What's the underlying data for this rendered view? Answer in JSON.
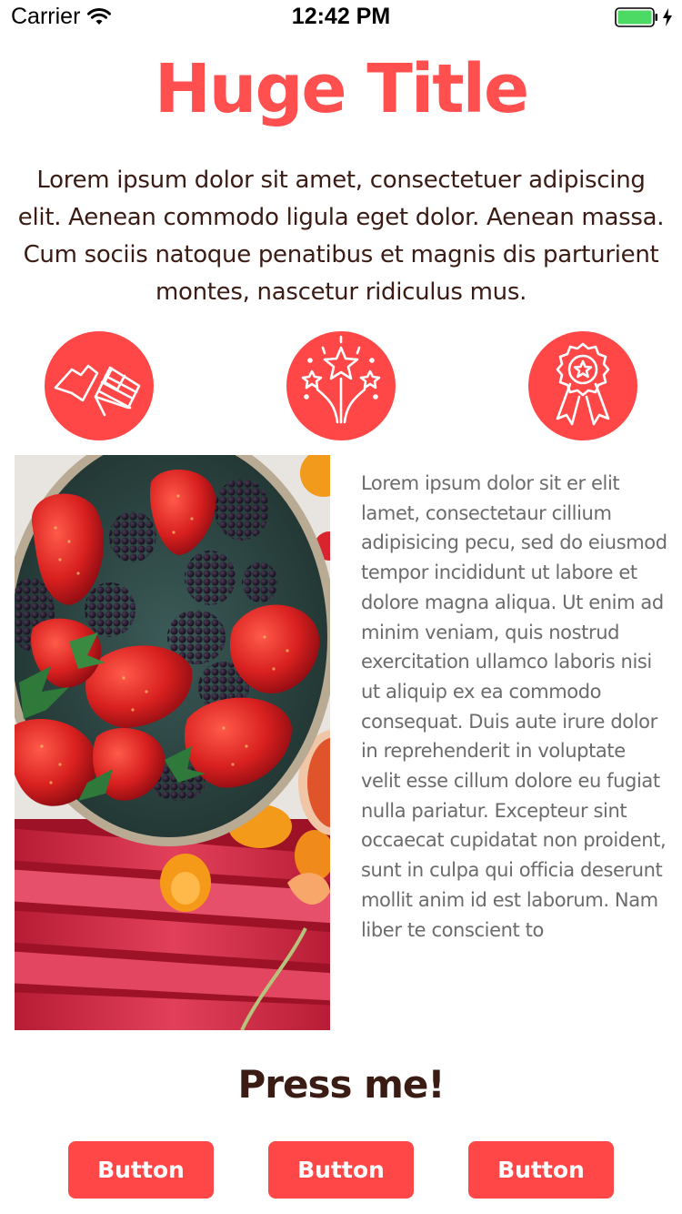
{
  "status_bar": {
    "carrier": "Carrier",
    "time": "12:42 PM",
    "wifi_icon": "wifi-icon",
    "battery_icon": "battery-icon",
    "charging_icon": "bolt-icon",
    "battery_color": "#4cd964"
  },
  "header": {
    "title": "Huge Title",
    "intro": "Lorem ipsum dolor sit amet, consectetuer adipiscing elit. Aenean commodo ligula eget dolor. Aenean massa. Cum sociis natoque penatibus et magnis dis parturient montes, nascetur ridiculus mus."
  },
  "icons": [
    {
      "name": "flags-icon"
    },
    {
      "name": "fireworks-star-icon"
    },
    {
      "name": "award-ribbon-icon"
    }
  ],
  "content": {
    "image": "strawberries-blackberries-rhubarb-photo",
    "body": "Lorem ipsum dolor sit er elit lamet, consectetaur cillium adipisicing pecu, sed do eiusmod tempor incididunt ut labore et dolore magna aliqua. Ut enim ad minim veniam, quis nostrud exercitation ullamco laboris nisi ut aliquip ex ea commodo consequat. Duis aute irure dolor in reprehenderit in voluptate velit esse cillum dolore eu fugiat nulla pariatur. Excepteur sint occaecat cupidatat non proident, sunt in culpa qui officia deserunt mollit anim id est laborum. Nam liber te conscient to"
  },
  "cta": {
    "title": "Press me!",
    "buttons": [
      "Button",
      "Button",
      "Button"
    ]
  },
  "colors": {
    "accent": "#ff4747",
    "title": "#ff4f4f",
    "dark_text": "#3a1c14",
    "body_text": "#6b6b6b"
  }
}
